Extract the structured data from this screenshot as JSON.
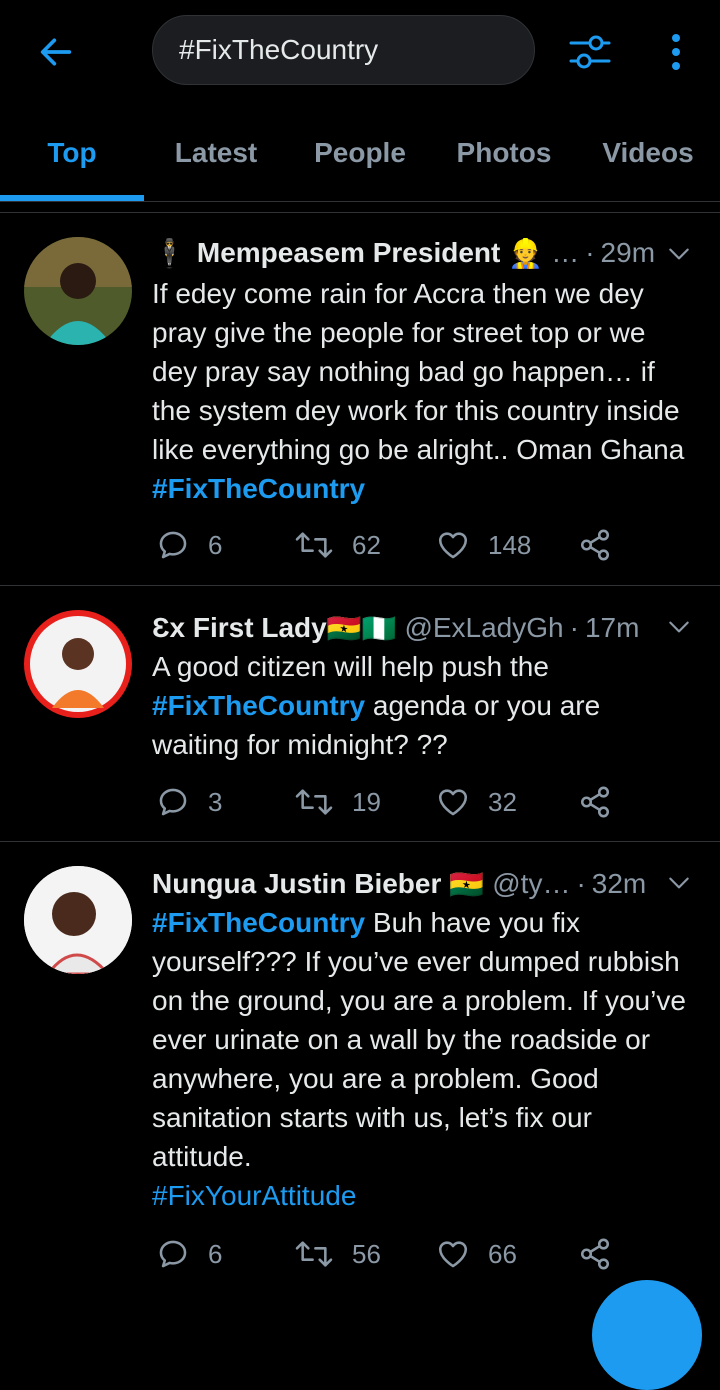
{
  "search": {
    "query": "#FixTheCountry"
  },
  "tabs": [
    {
      "label": "Top"
    },
    {
      "label": "Latest"
    },
    {
      "label": "People"
    },
    {
      "label": "Photos"
    },
    {
      "label": "Videos"
    }
  ],
  "colors": {
    "accent": "#1d9bf0",
    "background": "#000000",
    "muted": "#8b98a5",
    "text": "#e6e9ea",
    "divider": "#2f3336"
  },
  "tweets": [
    {
      "name_prefix": "🕴",
      "name": "Mempeasem President",
      "name_suffix": "👷",
      "handle": "…",
      "dot": "·",
      "time": "29m",
      "body_text": "If edey come rain for Accra then we dey pray give the people for street top or we dey pray say nothing bad go happen… if the system dey work for this country inside like everything go be alright.. Oman Ghana ",
      "body_hashtag": "#FixTheCountry",
      "replies": "6",
      "retweets": "62",
      "likes": "148"
    },
    {
      "name": "Ɛx First Lady",
      "name_suffix": "🇬🇭🇳🇬",
      "handle": "@ExLadyGh",
      "dot": "·",
      "time": "17m",
      "body_prefix": "A good citizen will help push the ",
      "body_hashtag": "#FixTheCountry",
      "body_text": " agenda or you are waiting for midnight? ??",
      "replies": "3",
      "retweets": "19",
      "likes": "32"
    },
    {
      "name": "Nungua Justin Bieber",
      "name_suffix": "🇬🇭",
      "handle": "@ty…",
      "dot": "·",
      "time": "32m",
      "body_hashtag": "#FixTheCountry",
      "body_text": " Buh have you fix yourself??? If you’ve ever dumped rubbish on the ground, you are a problem. If you’ve ever urinate on a wall by the roadside or anywhere, you are a problem. Good sanitation starts with us, let’s fix our attitude.",
      "body_hashtag2": "#FixYourAttitude",
      "replies": "6",
      "retweets": "56",
      "likes": "66"
    }
  ]
}
